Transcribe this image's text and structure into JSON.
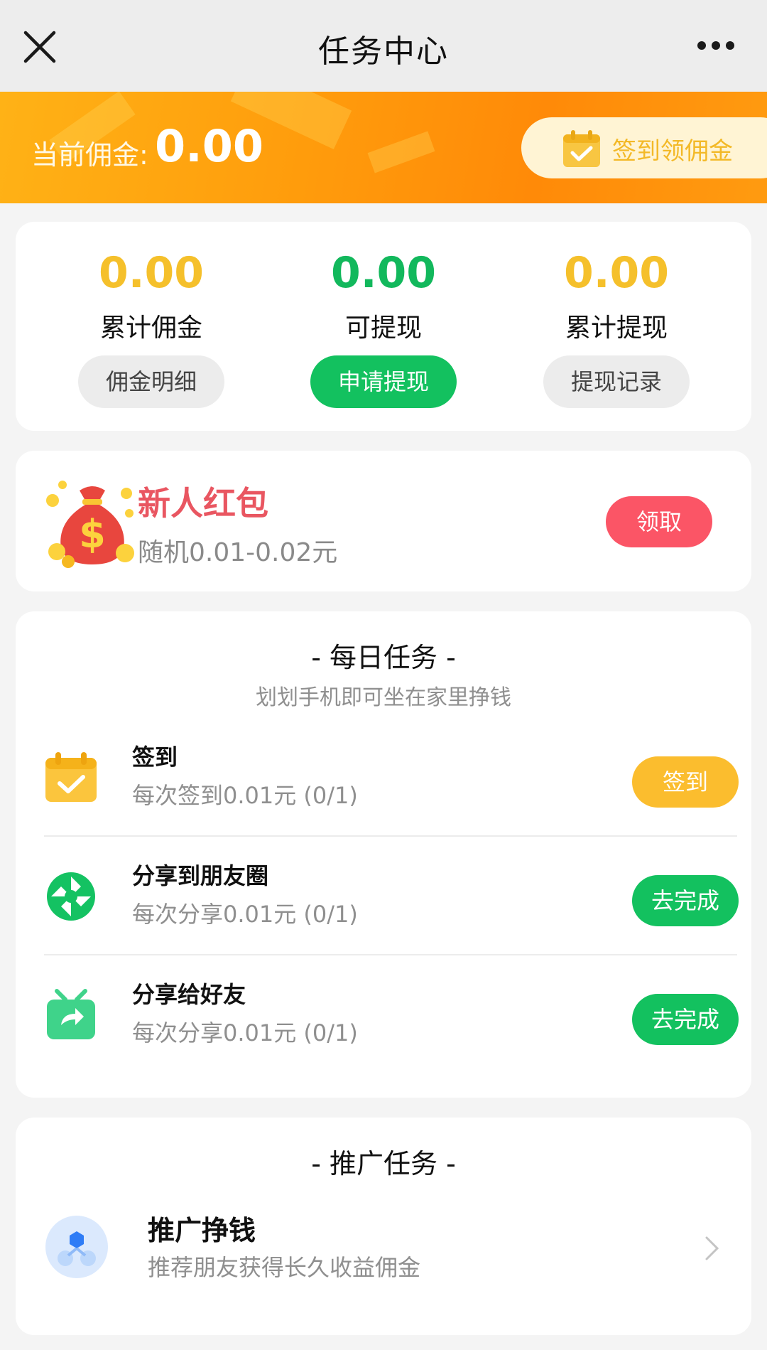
{
  "nav": {
    "title": "任务中心",
    "close_icon": "close-icon",
    "more_icon": "more-icon"
  },
  "banner": {
    "label": "当前佣金:",
    "value": "0.00",
    "checkin_label": "签到领佣金",
    "checkin_icon": "calendar-check-icon"
  },
  "stats": [
    {
      "value": "0.00",
      "label": "累计佣金",
      "button": "佣金明细",
      "color": "#f5c02b"
    },
    {
      "value": "0.00",
      "label": "可提现",
      "button": "申请提现",
      "color": "#12b85c"
    },
    {
      "value": "0.00",
      "label": "累计提现",
      "button": "提现记录",
      "color": "#f5c02b"
    }
  ],
  "red_packet": {
    "title": "新人红包",
    "subtitle": "随机0.01-0.02元",
    "button": "领取",
    "icon": "money-bag-icon"
  },
  "daily": {
    "title": "- 每日任务 -",
    "subtitle": "划划手机即可坐在家里挣钱",
    "tasks": [
      {
        "name": "签到",
        "desc": "每次签到0.01元 (0/1)",
        "button": "签到",
        "button_color": "#fbbd2e",
        "icon": "calendar-check-icon"
      },
      {
        "name": "分享到朋友圈",
        "desc": "每次分享0.01元 (0/1)",
        "button": "去完成",
        "button_color": "#13c15f",
        "icon": "moments-icon"
      },
      {
        "name": "分享给好友",
        "desc": "每次分享0.01元 (0/1)",
        "button": "去完成",
        "button_color": "#13c15f",
        "icon": "share-gift-icon"
      }
    ]
  },
  "promo": {
    "title": "- 推广任务 -",
    "item_title": "推广挣钱",
    "item_sub": "推荐朋友获得长久收益佣金",
    "icon": "network-icon"
  }
}
